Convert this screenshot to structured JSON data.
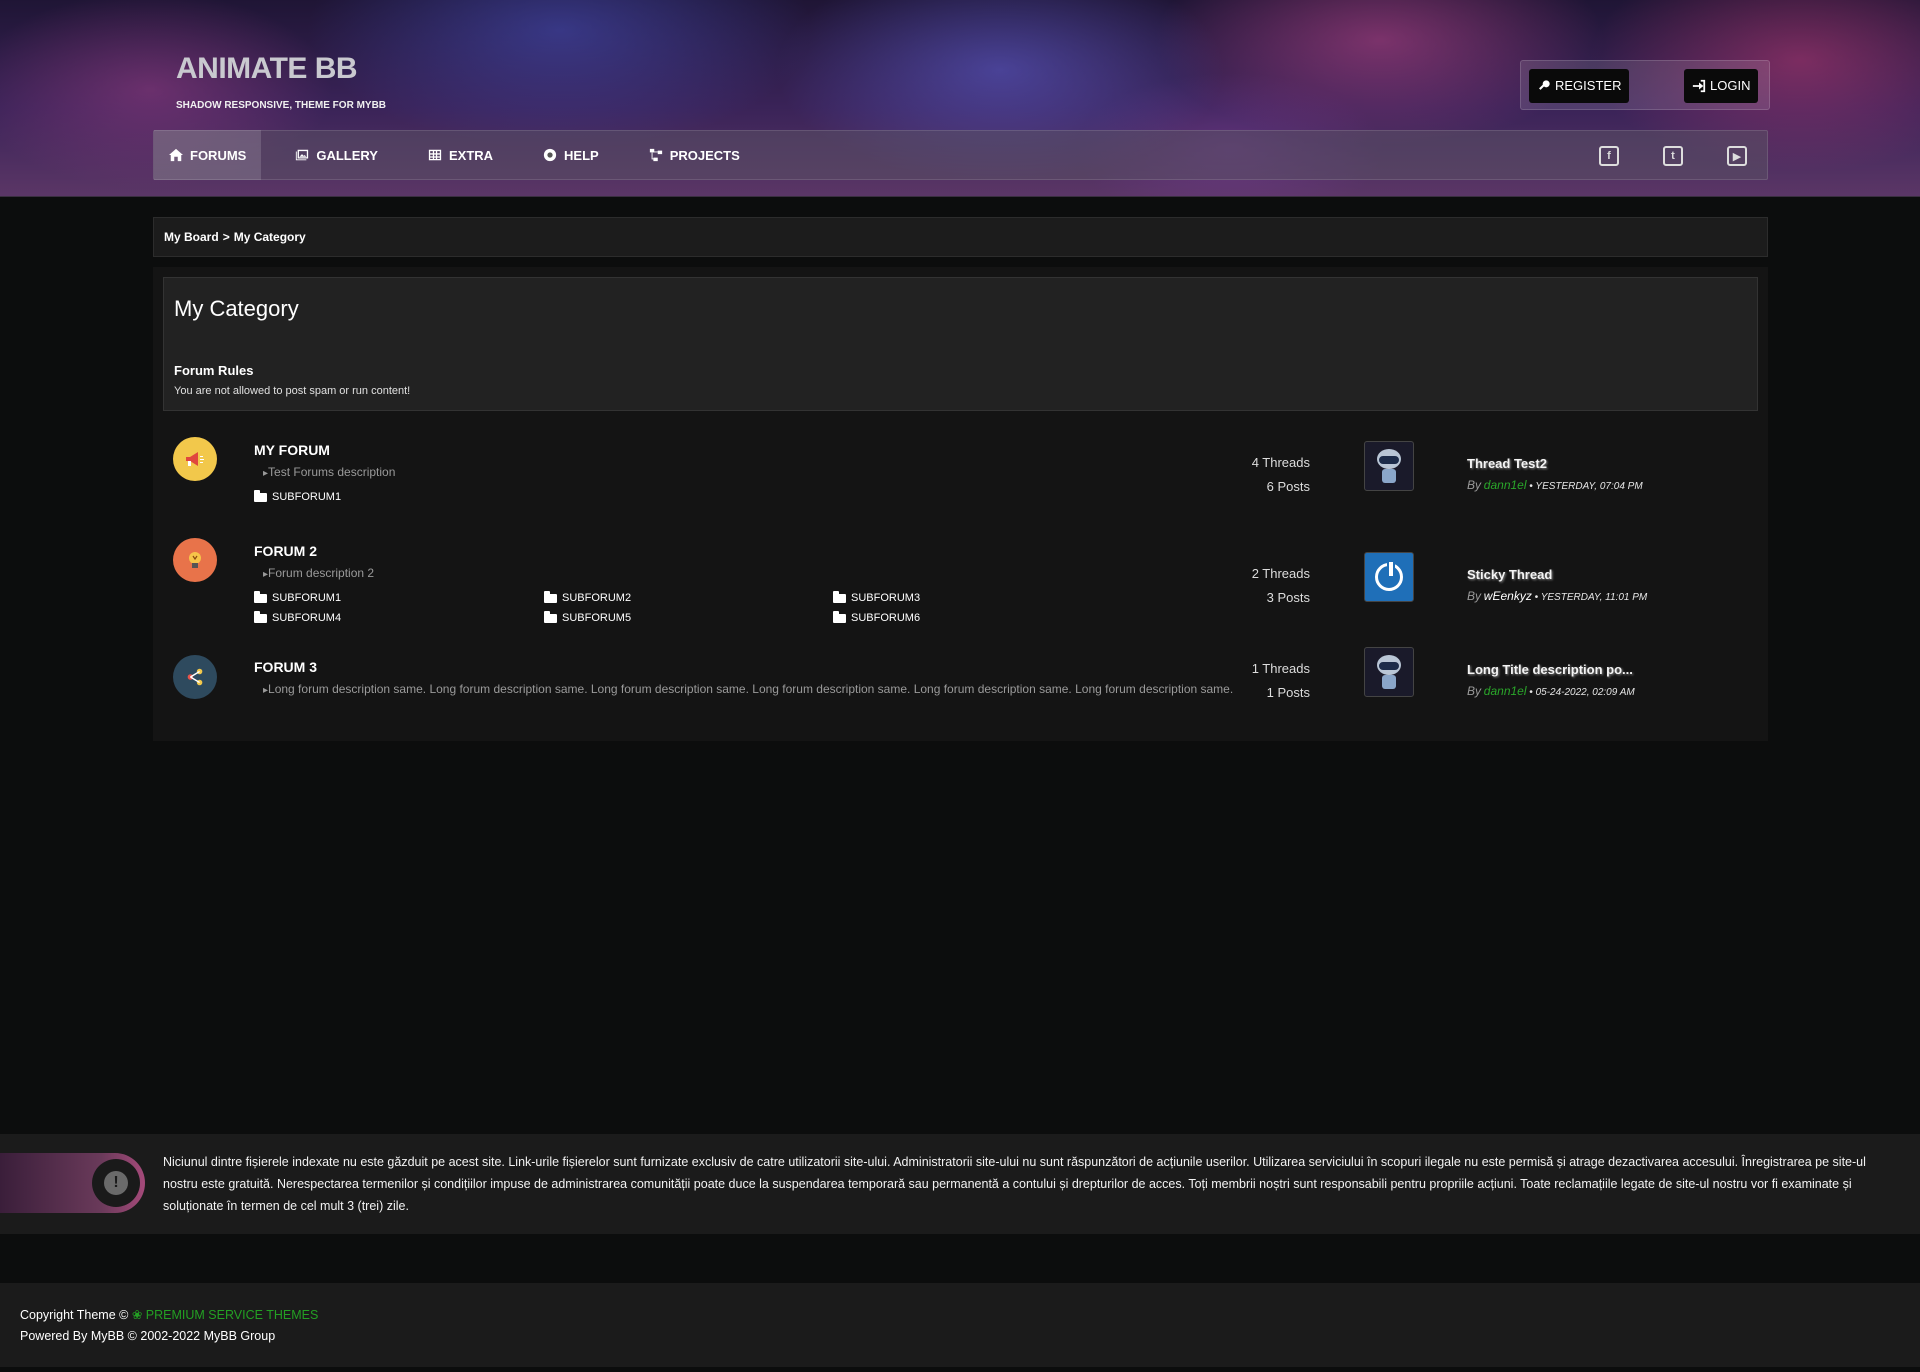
{
  "header": {
    "logo_title": "ANIMATE BB",
    "logo_subtitle": "SHADOW RESPONSIVE, THEME FOR MYBB",
    "register_label": "REGISTER",
    "login_label": "LOGIN"
  },
  "nav": {
    "items": [
      {
        "label": "FORUMS",
        "icon": "home-icon"
      },
      {
        "label": "GALLERY",
        "icon": "images-icon"
      },
      {
        "label": "EXTRA",
        "icon": "grid-icon"
      },
      {
        "label": "HELP",
        "icon": "lifebuoy-icon"
      },
      {
        "label": "PROJECTS",
        "icon": "sitemap-icon"
      }
    ],
    "socials": [
      "facebook-icon",
      "twitter-icon",
      "youtube-icon"
    ]
  },
  "breadcrumb": {
    "root": "My Board",
    "separator": ">",
    "current": "My Category"
  },
  "category": {
    "title": "My Category",
    "rules_title": "Forum Rules",
    "rules_text": "You are not allowed to post spam or run content!"
  },
  "forums": [
    {
      "name": "MY FORUM",
      "description": "Test Forums description",
      "icon": "megaphone-icon",
      "icon_color": "#f2c84b",
      "subforums": [
        "SUBFORUM1"
      ],
      "threads": "4 Threads",
      "posts": "6 Posts",
      "last_post": {
        "title": "Thread Test2",
        "by": "By",
        "user": "dann1el",
        "date": "• YESTERDAY, 07:04 PM"
      }
    },
    {
      "name": "FORUM 2",
      "description": "Forum description 2",
      "icon": "lightbulb-icon",
      "icon_color": "#e8734a",
      "subforums": [
        "SUBFORUM1",
        "SUBFORUM2",
        "SUBFORUM3",
        "SUBFORUM4",
        "SUBFORUM5",
        "SUBFORUM6"
      ],
      "threads": "2 Threads",
      "posts": "3 Posts",
      "last_post": {
        "title": "Sticky Thread",
        "by": "By",
        "user": "wEenkyz",
        "date": "• YESTERDAY, 11:01 PM"
      }
    },
    {
      "name": "FORUM 3",
      "description": "Long forum description same. Long forum description same. Long forum description same. Long forum description same. Long forum description same. Long forum description same.",
      "icon": "share-icon",
      "icon_color": "#2e4a5e",
      "subforums": [],
      "threads": "1 Threads",
      "posts": "1 Posts",
      "last_post": {
        "title": "Long Title description po...",
        "by": "By",
        "user": "dann1el",
        "date": "• 05-24-2022, 02:09 AM"
      }
    }
  ],
  "disclaimer": {
    "text": "Niciunul dintre fișierele indexate nu este găzduit pe acest site. Link-urile fișierelor sunt furnizate exclusiv de catre utilizatorii site-ului. Administratorii site-ului nu sunt răspunzători de acțiunile userilor. Utilizarea serviciului în scopuri ilegale nu este permisă și atrage dezactivarea accesului. Înregistrarea pe site-ul nostru este gratuită. Nerespectarea termenilor și condițiilor impuse de administrarea comunității poate duce la suspendarea temporară sau permanentă a contului și drepturilor de acces. Toți membrii noștri sunt responsabili pentru propriile acțiuni. Toate reclamațiile legate de site-ul nostru vor fi examinate și soluționate în termen de cel mult 3 (trei) zile."
  },
  "footer": {
    "copyright_prefix": "Copyright Theme ©",
    "brand": "PREMIUM SERVICE THEMES",
    "powered": "Powered By MyBB © 2002-2022 MyBB Group"
  },
  "colors": {
    "accent_green": "#2aa62a",
    "background": "#0c0d0d"
  }
}
